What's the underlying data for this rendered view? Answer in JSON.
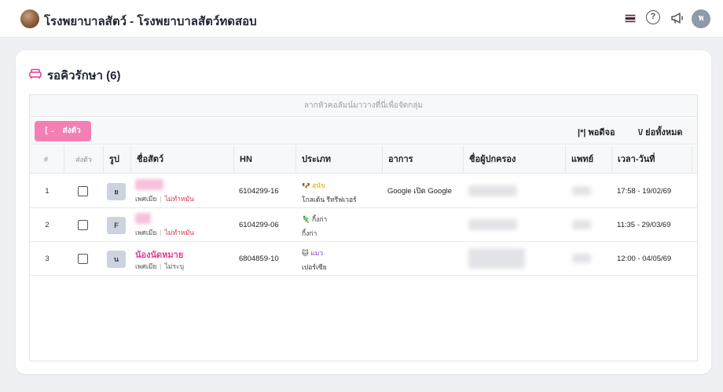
{
  "app": {
    "title": "โรงพยาบาลสัตว์ - โรงพยาบาลสัตว์ทดสอบ",
    "avatar_letter": "พ",
    "help_glyph": "?"
  },
  "card": {
    "title": "รอคิวรักษา (6)"
  },
  "grid": {
    "group_placeholder": "ลากหัวคอลัมน์มาวางที่นี่เพื่อจัดกลุ่ม",
    "send_button": {
      "arrow": "[→",
      "label": "ส่งตัว"
    },
    "autofit_label": "|*| พอดีจอ",
    "collapse_label": "\\/ ย่อทั้งหมด",
    "columns": [
      "#",
      "ส่งตัว",
      "รูป",
      "ชื่อสัตว์",
      "HN",
      "ประเภท",
      "อาการ",
      "ชื่อผู้ปกครอง",
      "แพทย์",
      "เวลา-วันที่"
    ],
    "rows": [
      {
        "index": "1",
        "pic": "ย",
        "name": "",
        "sex": "เพศเมีย",
        "neuter": "ไม่ทำหมัน",
        "neuter_red": true,
        "hn": "6104299-16",
        "type_icon": "🐶",
        "type": "สุนัข",
        "breed": "โกลเด้น รีทรีฟเวอร์",
        "symptom": "Google เปิด Google",
        "time": "17:58 - 19/02/69"
      },
      {
        "index": "2",
        "pic": "F",
        "name": "",
        "sex": "เพศเมีย",
        "neuter": "ไม่ทำหมัน",
        "neuter_red": true,
        "hn": "6104299-06",
        "type_icon": "🦎",
        "type": "กิ้งก่า",
        "breed": "กิ้งก่า",
        "symptom": "",
        "time": "11:35 - 29/03/69"
      },
      {
        "index": "3",
        "pic": "น",
        "name": "น้องนัดหมาย",
        "sex": "เพศเมีย",
        "neuter": "ไม่ระบุ",
        "neuter_red": false,
        "hn": "6804859-10",
        "type_icon": "🐱",
        "type": "แมว",
        "breed": "เปอร์เซีย",
        "symptom": "",
        "time": "12:00 - 04/05/69"
      }
    ]
  },
  "colors": {
    "accent_pink": "#f47fb4",
    "name_pink": "#e6398f",
    "dog_yellow": "#e0a800",
    "cat_purple": "#7a3fc0",
    "lizard_dark": "#333333",
    "neuter_red": "#d9364b"
  }
}
